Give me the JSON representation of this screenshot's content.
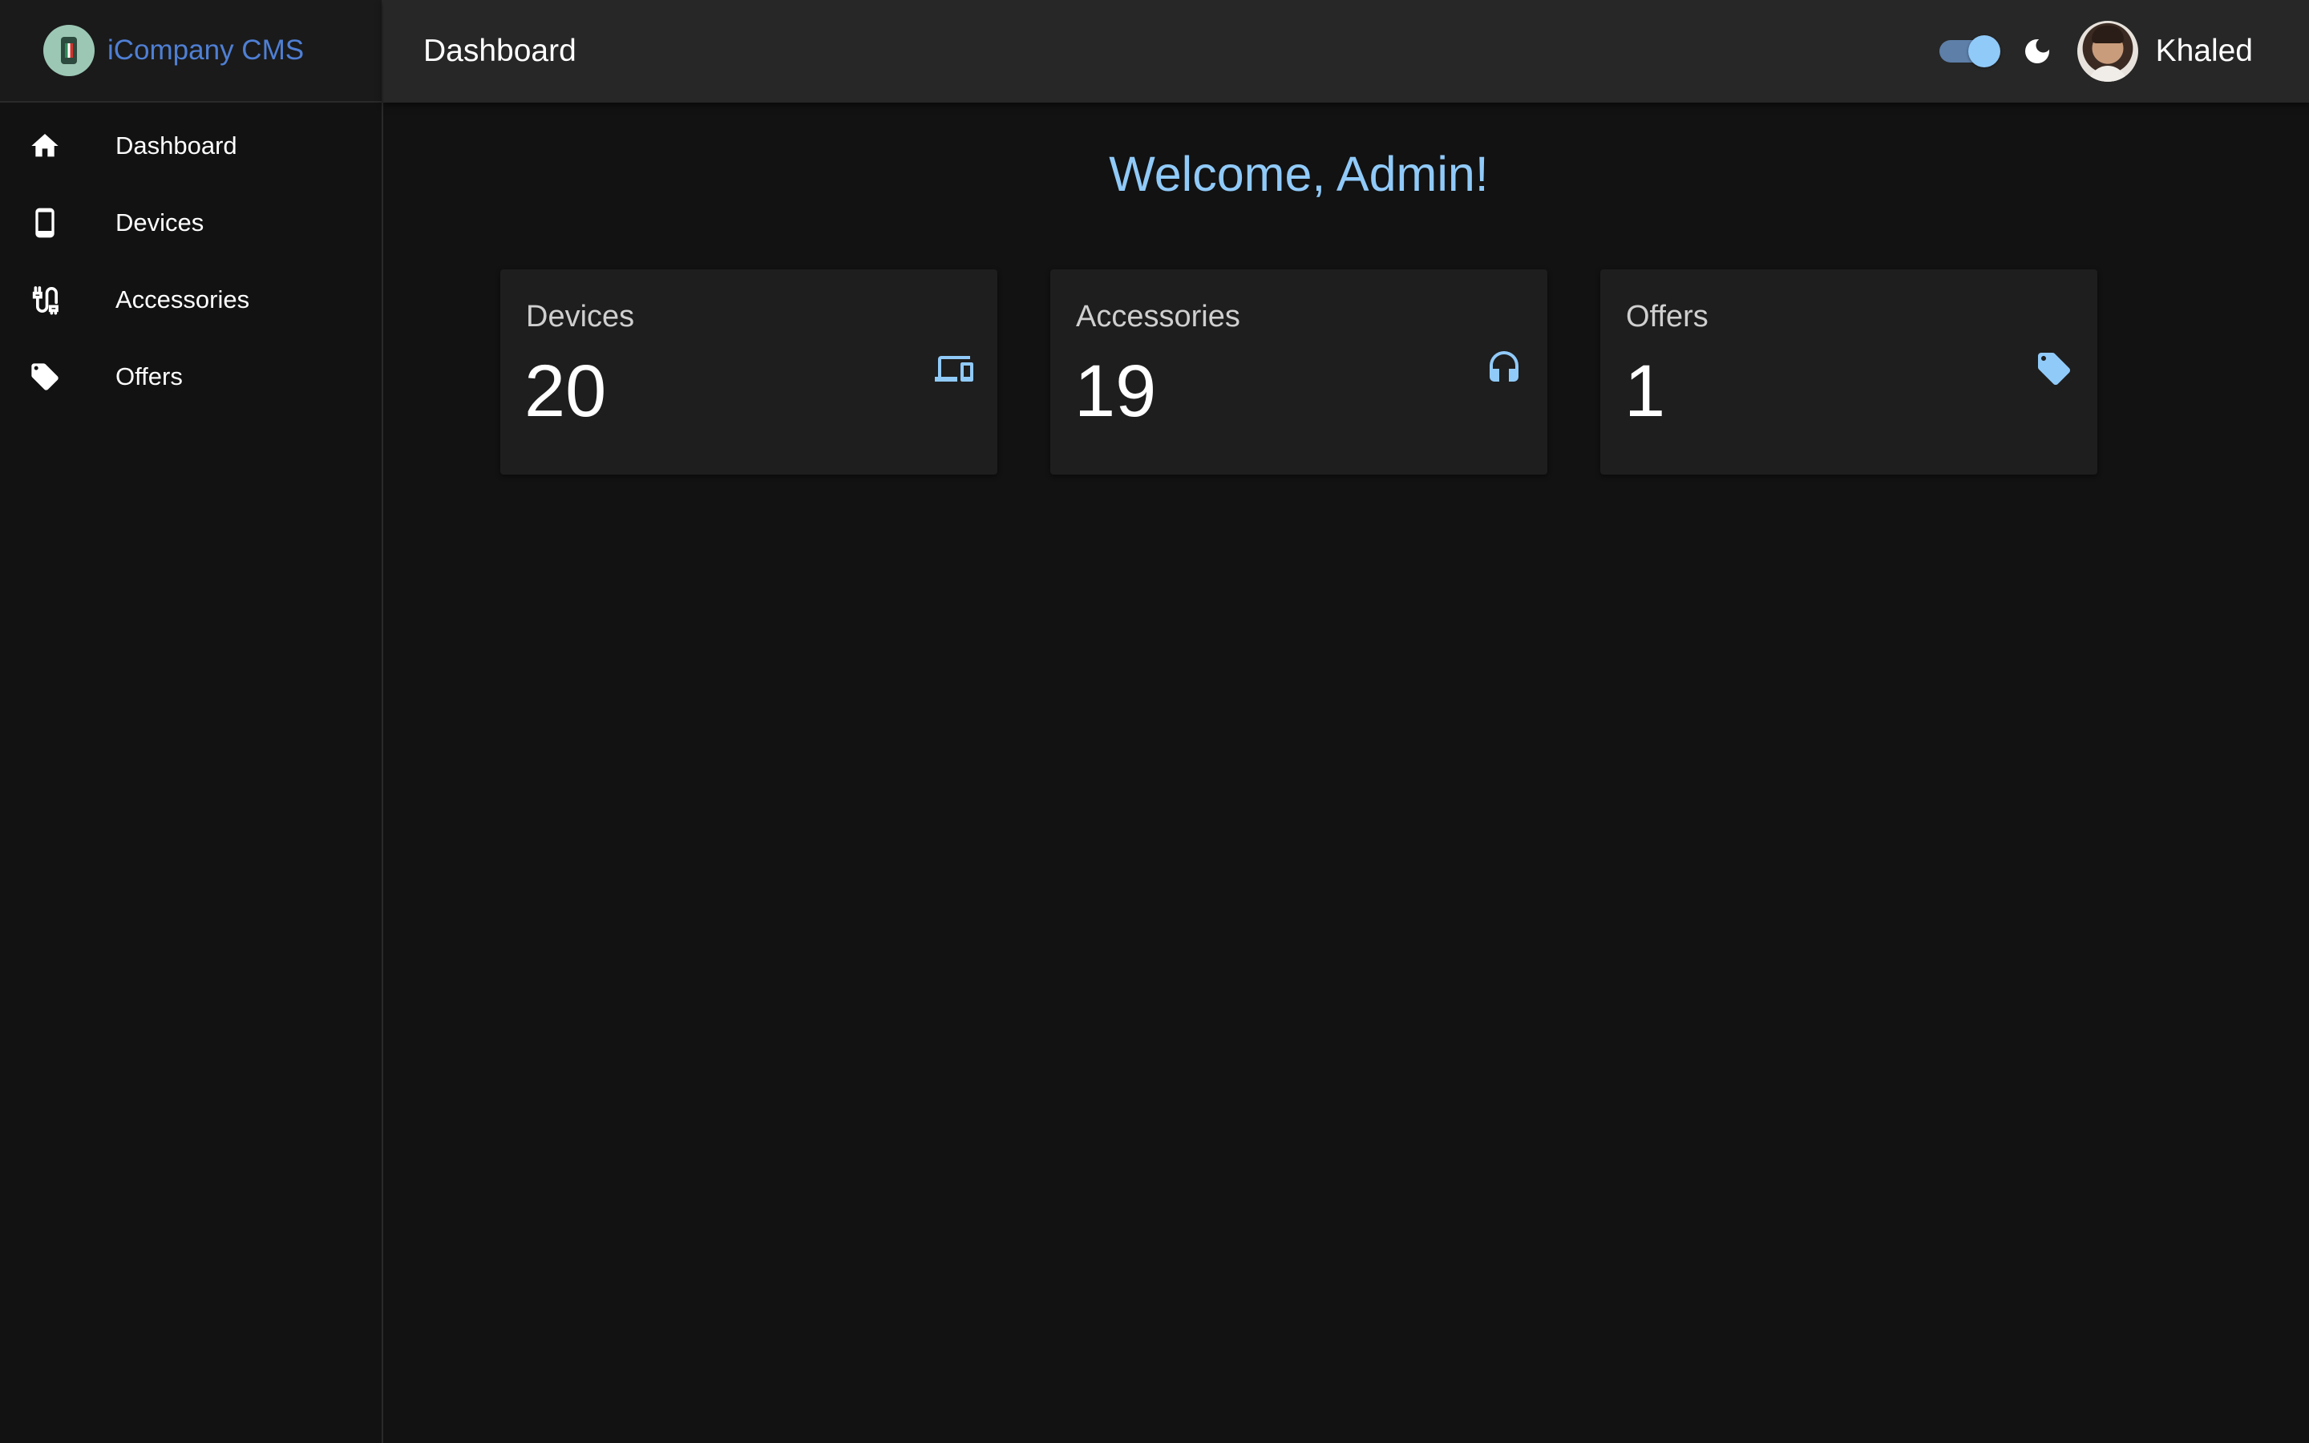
{
  "brand": {
    "name": "iCompany CMS",
    "logo_icon": "phone-logo-icon"
  },
  "sidebar": {
    "items": [
      {
        "label": "Dashboard",
        "icon": "home-icon"
      },
      {
        "label": "Devices",
        "icon": "smartphone-icon"
      },
      {
        "label": "Accessories",
        "icon": "cable-icon"
      },
      {
        "label": "Offers",
        "icon": "tag-icon"
      }
    ]
  },
  "topbar": {
    "title": "Dashboard",
    "theme_toggle_on": true,
    "theme_icon": "moon-icon",
    "user_name": "Khaled"
  },
  "main": {
    "welcome": "Welcome, Admin!",
    "cards": [
      {
        "title": "Devices",
        "value": "20",
        "icon": "devices-icon"
      },
      {
        "title": "Accessories",
        "value": "19",
        "icon": "headphones-icon"
      },
      {
        "title": "Offers",
        "value": "1",
        "icon": "tag-icon"
      }
    ]
  },
  "colors": {
    "accent": "#90caf9",
    "brand_text": "#4f7fd4",
    "background": "#121212",
    "card_bg": "#1e1e1e",
    "topbar_bg": "#272727"
  }
}
